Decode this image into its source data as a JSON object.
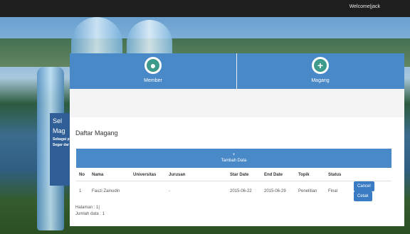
{
  "topbar": {
    "welcome": "Welcome|jack"
  },
  "background": {
    "promo_big": [
      "Sel",
      "Mag"
    ],
    "promo_small": [
      "Sebagai p",
      "Segar dar"
    ]
  },
  "nav": [
    {
      "label": "Member",
      "icon": "user-icon",
      "glyph": "●"
    },
    {
      "label": "Magang",
      "icon": "plus-icon",
      "glyph": "+"
    }
  ],
  "main": {
    "title": "Daftar Magang",
    "add_plus": "+",
    "add_label": "Tambah Data",
    "columns": [
      "No",
      "Nama",
      "Universitas",
      "Jurusan",
      "Star Date",
      "End Date",
      "Topik",
      "Status",
      ""
    ],
    "rows": [
      {
        "no": "1",
        "nama": "Fauzi Zainudin",
        "universitas": "",
        "jurusan": "-",
        "star_date": "2015-06-22",
        "end_date": "2015-06-29",
        "topik": "Penelitian",
        "status": "Final",
        "cancel": "Cancel",
        "cetak": "Cetak"
      }
    ],
    "halaman": "Halaman : 1|",
    "jumlah": "Jumlah data : 1"
  },
  "colors": {
    "header": "#4a89c8",
    "button": "#3a7cc4",
    "icon_circle": "#3e9b8b"
  }
}
